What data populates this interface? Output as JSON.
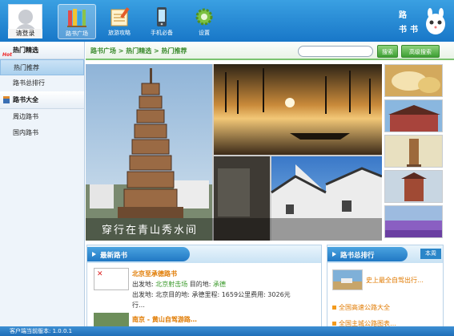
{
  "header": {
    "login_label": "请登录",
    "nav": [
      {
        "label": "路书广场",
        "icon": "books-icon"
      },
      {
        "label": "旅游攻略",
        "icon": "notebook-icon"
      },
      {
        "label": "手机必备",
        "icon": "phone-icon"
      },
      {
        "label": "设置",
        "icon": "gear-icon"
      }
    ],
    "logo_chars": [
      "路",
      "书",
      "路",
      "书"
    ]
  },
  "sidebar": {
    "hot_badge": "Hot",
    "section1": "热门精选",
    "items1": [
      "热门推荐",
      "路书总排行"
    ],
    "section2": "路书大全",
    "items2": [
      "周边路书",
      "国内路书"
    ]
  },
  "breadcrumb": "路书广场 > 热门精选 > 热门推荐",
  "search": {
    "button": "搜索",
    "advanced_button": "高级搜索"
  },
  "hero": {
    "caption": "穿行在青山秀水间"
  },
  "new_books": {
    "title": "最新路书",
    "entries": [
      {
        "title": "北京至承德路书",
        "from_label": "出发地:",
        "from_value": "北京射击场",
        "dest_label": "目的地:",
        "dest_value": "承德",
        "line2": "出发地: 北京目的地: 承德里程: 1659公里费用: 3026元",
        "line3": "行…"
      },
      {
        "title": "南京 - 黄山自驾游路…"
      }
    ]
  },
  "ranking": {
    "title": "路书总排行",
    "week_badge": "本周",
    "top_entry": "史上最全自驾出行…",
    "items": [
      "全国高速公路大全",
      "全国主城公路图表…"
    ]
  },
  "status": {
    "version_text": "客户端当前版本: 1.0.0.1"
  },
  "colors": {
    "topbar": "#2a8ad6",
    "accent_green": "#3a8a2c",
    "orange": "#e07a00"
  }
}
